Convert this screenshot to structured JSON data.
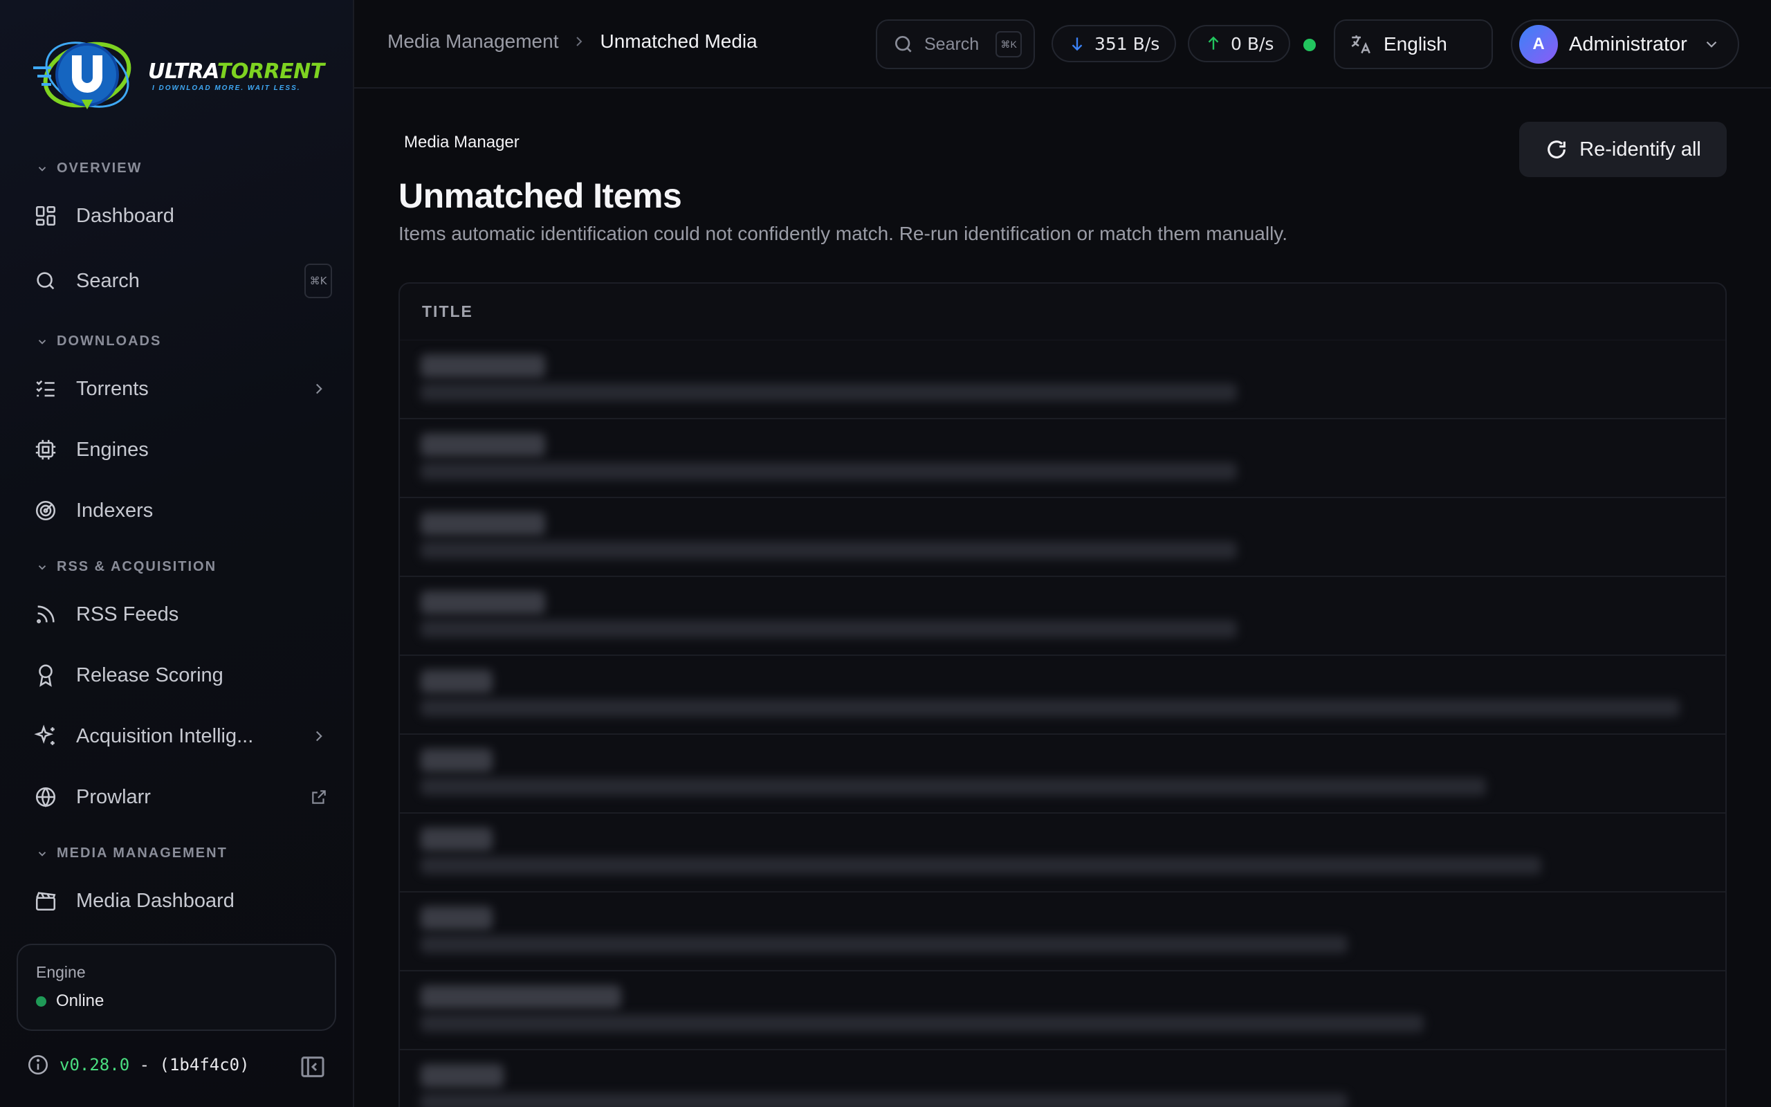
{
  "app": {
    "logo": {
      "word_a": "ULTRA",
      "word_b": "TORRENT",
      "tagline": "I DOWNLOAD MORE. WAIT LESS."
    }
  },
  "sidebar": {
    "sections": {
      "overview": "OVERVIEW",
      "downloads": "DOWNLOADS",
      "rss": "RSS & ACQUISITION",
      "media": "MEDIA MANAGEMENT"
    },
    "items": {
      "dashboard": "Dashboard",
      "search": "Search",
      "search_kbd": "⌘K",
      "torrents": "Torrents",
      "engines": "Engines",
      "indexers": "Indexers",
      "rss_feeds": "RSS Feeds",
      "release_scoring": "Release Scoring",
      "acquisition": "Acquisition Intellig...",
      "prowlarr": "Prowlarr",
      "media_dashboard": "Media Dashboard"
    },
    "engine": {
      "label": "Engine",
      "status": "Online"
    },
    "version": {
      "number": "v0.28.0",
      "sep": " - ",
      "commit": "(1b4f4c0)"
    }
  },
  "topbar": {
    "breadcrumb": {
      "parent": "Media Management",
      "current": "Unmatched Media"
    },
    "search": {
      "placeholder": "Search",
      "kbd": "⌘K"
    },
    "download_speed": "351 B/s",
    "upload_speed": "0 B/s",
    "language": "English",
    "user": {
      "initial": "A",
      "name": "Administrator"
    }
  },
  "main": {
    "eyebrow": "Media Manager",
    "title": "Unmatched Items",
    "description": "Items automatic identification could not confidently match. Re-run identification or match them manually.",
    "reidentify_label": "Re-identify all",
    "table": {
      "column_title": "TITLE",
      "rows": [
        {
          "title": "",
          "subtitle": ""
        },
        {
          "title": "",
          "subtitle": ""
        },
        {
          "title": "",
          "subtitle": ""
        },
        {
          "title": "",
          "subtitle": ""
        },
        {
          "title": "",
          "subtitle": ""
        },
        {
          "title": "",
          "subtitle": ""
        },
        {
          "title": "",
          "subtitle": ""
        },
        {
          "title": "",
          "subtitle": ""
        },
        {
          "title": "",
          "subtitle": ""
        },
        {
          "title": "",
          "subtitle": ""
        }
      ]
    }
  },
  "colors": {
    "accent_green": "#22c55e",
    "download_blue": "#3b82f6",
    "version_green": "#4ade80"
  }
}
